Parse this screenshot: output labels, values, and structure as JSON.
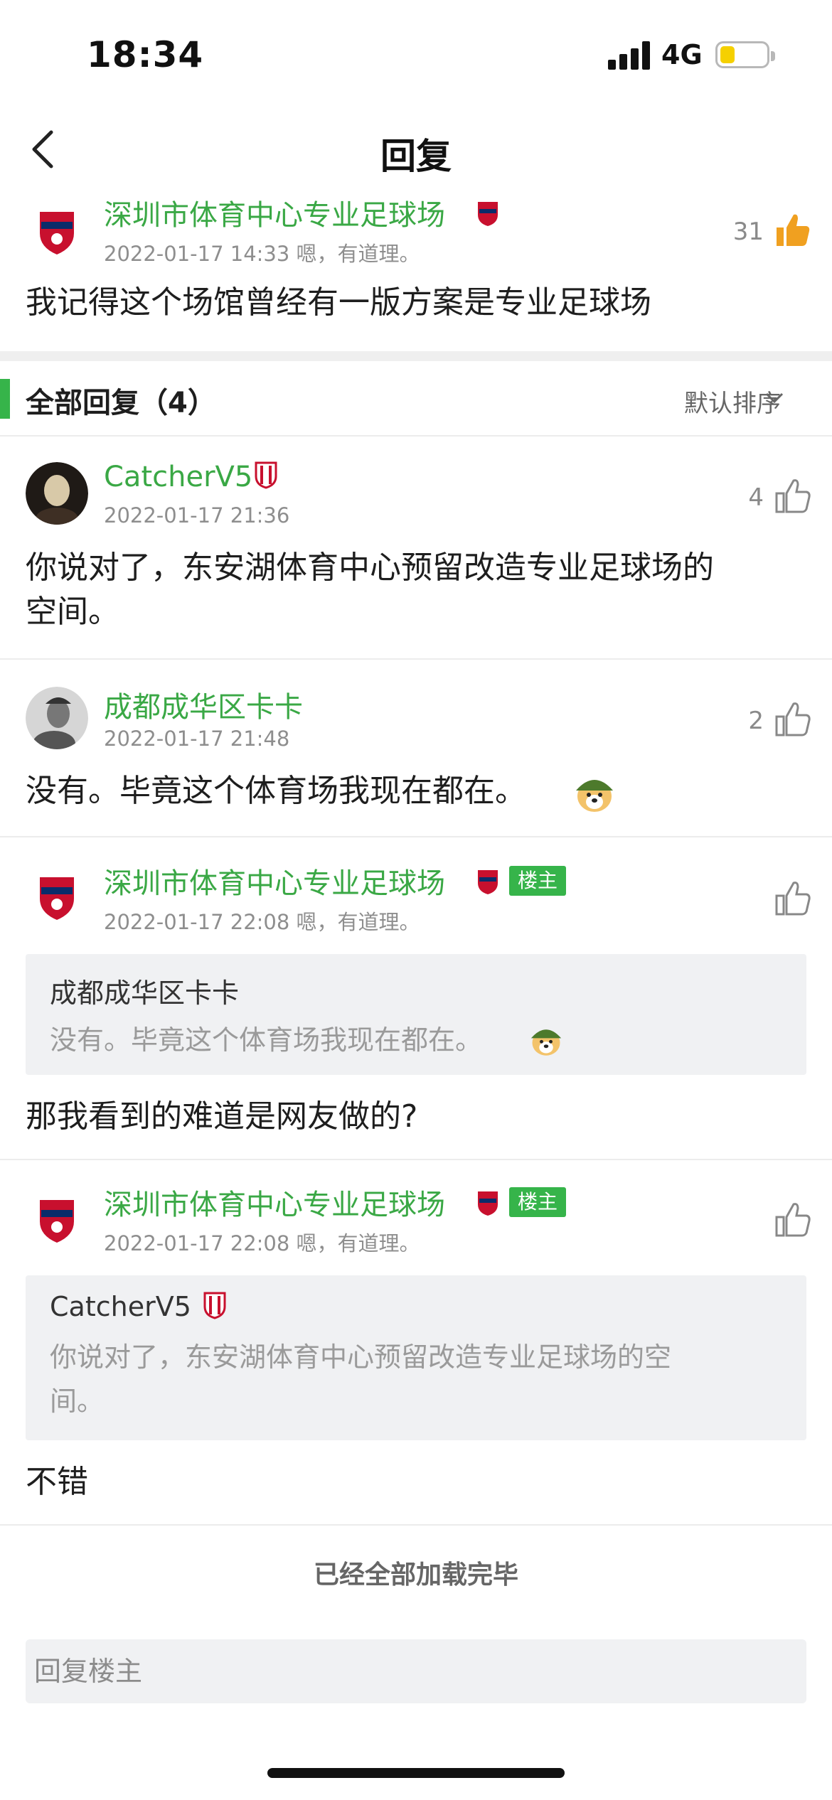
{
  "status_bar": {
    "time": "18:34",
    "network": "4G",
    "battery_color": "#f5d000"
  },
  "nav": {
    "title": "回复"
  },
  "original_post": {
    "username": "深圳市体育中心专业足球场",
    "timestamp": "2022-01-17 14:33",
    "signature": "嗯，有道理。",
    "likes": "31",
    "content": "我记得这个场馆曾经有一版方案是专业足球场"
  },
  "replies_header": {
    "title": "全部回复（4）",
    "sort_label": "默认排序"
  },
  "replies": [
    {
      "username": "CatcherV5",
      "timestamp": "2022-01-17 21:36",
      "likes": "4",
      "content_line1": "你说对了，东安湖体育中心预留改造专业足球场的",
      "content_line2": "空间。"
    },
    {
      "username": "成都成华区卡卡",
      "timestamp": "2022-01-17 21:48",
      "likes": "2",
      "content": "没有。毕竟这个体育场我现在都在。"
    },
    {
      "username": "深圳市体育中心专业足球场",
      "badge": "楼主",
      "timestamp": "2022-01-17 22:08",
      "signature": "嗯，有道理。",
      "quote_name": "成都成华区卡卡",
      "quote_text": "没有。毕竟这个体育场我现在都在。",
      "content": "那我看到的难道是网友做的?"
    },
    {
      "username": "深圳市体育中心专业足球场",
      "badge": "楼主",
      "timestamp": "2022-01-17 22:08",
      "signature": "嗯，有道理。",
      "quote_name": "CatcherV5",
      "quote_text_line1": "你说对了，东安湖体育中心预留改造专业足球场的空",
      "quote_text_line2": "间。",
      "content": "不错"
    }
  ],
  "footer": {
    "loaded_text": "已经全部加载完毕",
    "reply_placeholder": "回复楼主"
  },
  "colors": {
    "accent_green": "#36b44a",
    "username_green": "#3aa845",
    "like_orange": "#f0a020"
  }
}
